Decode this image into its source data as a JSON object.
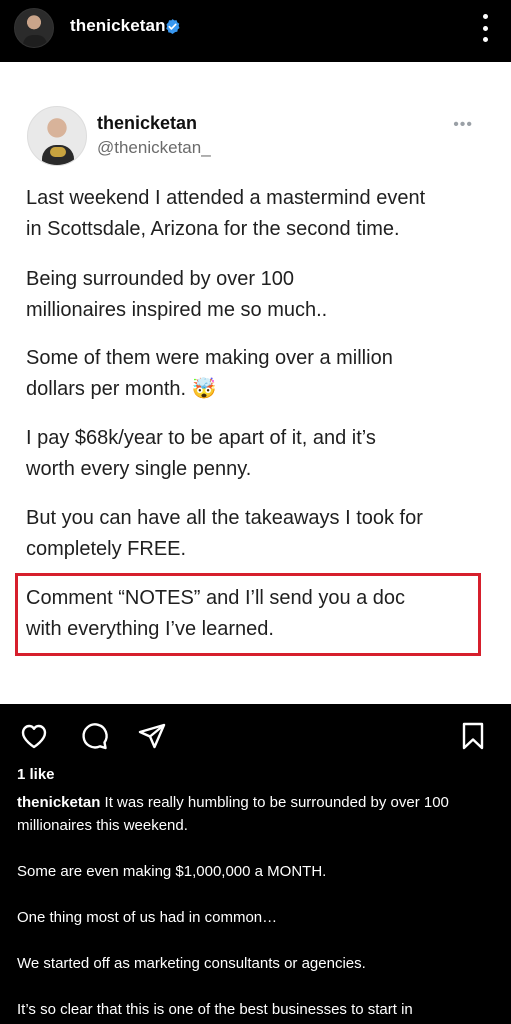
{
  "header": {
    "username": "thenicketan",
    "verified_color": "#3897f0"
  },
  "tweet": {
    "name": "thenicketan",
    "handle": "@thenicketan_",
    "more": "•••",
    "paragraphs": [
      "Last weekend I attended a mastermind event\nin Scottsdale, Arizona for the second time.",
      "Being surrounded by over 100\nmillionaires inspired me so much..",
      "Some of them were making over a million\ndollars per month. 🤯",
      "I pay $68k/year to be apart of it, and it’s\nworth every single penny.",
      "But you can have all the takeaways I took for\ncompletely FREE.",
      "Comment “NOTES” and I’ll send you a doc\nwith everything I’ve learned."
    ],
    "highlight_color": "#d61f2c"
  },
  "actions": {
    "icons": [
      "heart-icon",
      "comment-icon",
      "share-icon",
      "bookmark-icon"
    ]
  },
  "engagement": {
    "likes": "1 like"
  },
  "caption": {
    "username": "thenicketan",
    "first_text": " It was really humbling to be surrounded by over 100 millionaires this weekend.",
    "lines": [
      "Some are even making $1,000,000 a MONTH.",
      "One thing most of us had in common…",
      "We started off as marketing consultants or agencies.",
      "It’s so clear that this is one of the best businesses to start in"
    ]
  }
}
